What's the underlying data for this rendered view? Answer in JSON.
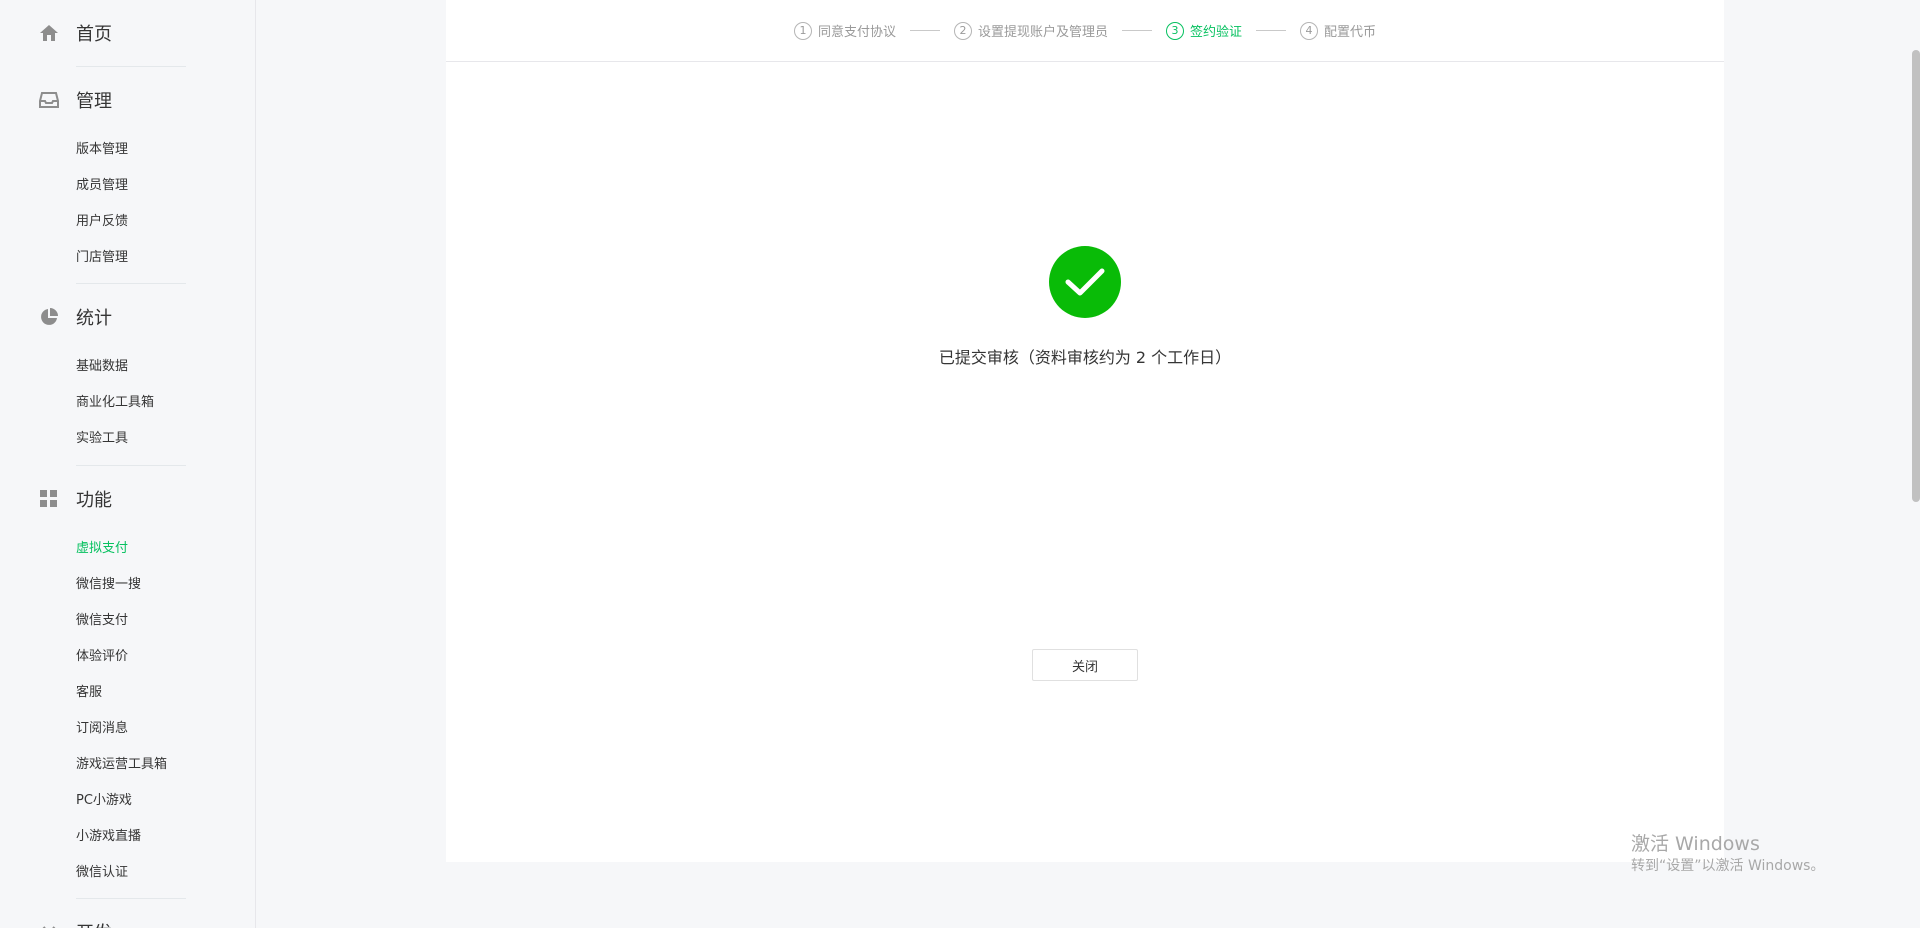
{
  "sidebar": {
    "home": {
      "label": "首页",
      "icon": "home-icon"
    },
    "groups": [
      {
        "label": "管理",
        "icon": "inbox-icon",
        "items": [
          "版本管理",
          "成员管理",
          "用户反馈",
          "门店管理"
        ]
      },
      {
        "label": "统计",
        "icon": "pie-chart-icon",
        "items": [
          "基础数据",
          "商业化工具箱",
          "实验工具"
        ]
      },
      {
        "label": "功能",
        "icon": "grid-icon",
        "items": [
          "虚拟支付",
          "微信搜一搜",
          "微信支付",
          "体验评价",
          "客服",
          "订阅消息",
          "游戏运营工具箱",
          "PC小游戏",
          "小游戏直播",
          "微信认证"
        ]
      },
      {
        "label": "开发",
        "icon": "code-icon"
      }
    ],
    "active_item": "虚拟支付"
  },
  "steps": [
    {
      "num": "1",
      "label": "同意支付协议",
      "state": "done"
    },
    {
      "num": "2",
      "label": "设置提现账户及管理员",
      "state": "done"
    },
    {
      "num": "3",
      "label": "签约验证",
      "state": "active"
    },
    {
      "num": "4",
      "label": "配置代币",
      "state": "todo"
    }
  ],
  "result": {
    "icon": "check-circle-icon",
    "message": "已提交审核（资料审核约为 2 个工作日）",
    "close_label": "关闭"
  },
  "watermark": {
    "line1": "激活 Windows",
    "line2": "转到“设置”以激活 Windows。"
  },
  "colors": {
    "accent": "#07c160",
    "success": "#09bb07"
  }
}
